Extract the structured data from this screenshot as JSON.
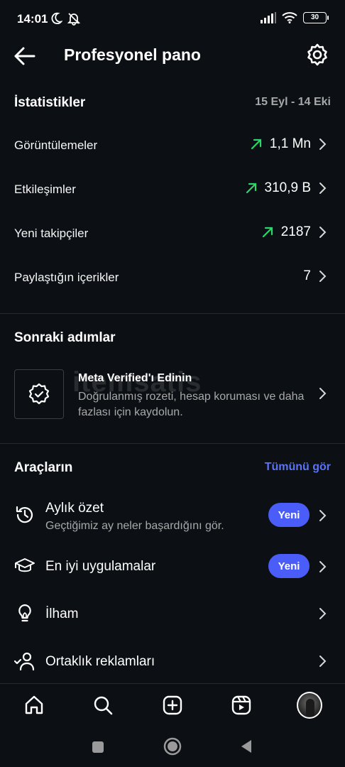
{
  "status_bar": {
    "time": "14:01",
    "battery": "30",
    "icons": [
      "moon-icon",
      "bell-off-icon",
      "signal-icon",
      "wifi-icon",
      "battery-icon"
    ]
  },
  "header": {
    "title": "Profesyonel pano",
    "back_icon": "arrow-left-icon",
    "settings_icon": "gear-icon"
  },
  "stats": {
    "title": "İstatistikler",
    "date_range": "15 Eyl - 14 Eki",
    "rows": [
      {
        "label": "Görüntülemeler",
        "value": "1,1 Mn",
        "trend": "up"
      },
      {
        "label": "Etkileşimler",
        "value": "310,9 B",
        "trend": "up"
      },
      {
        "label": "Yeni takipçiler",
        "value": "2187",
        "trend": "up"
      },
      {
        "label": "Paylaştığın içerikler",
        "value": "7",
        "trend": "none"
      }
    ]
  },
  "next_steps": {
    "title": "Sonraki adımlar",
    "card": {
      "title": "Meta Verified'ı Edinin",
      "description": "Doğrulanmış rozeti, hesap koruması ve daha fazlası için kaydolun.",
      "icon": "verified-badge-icon"
    }
  },
  "watermark": "itemsatis",
  "tools": {
    "title": "Araçların",
    "see_all": "Tümünü gör",
    "items": [
      {
        "title": "Aylık özet",
        "subtitle": "Geçtiğimiz ay neler başardığını gör.",
        "badge": "Yeni",
        "icon": "history-icon"
      },
      {
        "title": "En iyi uygulamalar",
        "subtitle": "",
        "badge": "Yeni",
        "icon": "graduation-cap-icon"
      },
      {
        "title": "İlham",
        "subtitle": "",
        "badge": "",
        "icon": "lightbulb-icon"
      },
      {
        "title": "Ortaklık reklamları",
        "subtitle": "",
        "badge": "",
        "icon": "partner-check-icon"
      }
    ]
  },
  "bottom_nav": {
    "items": [
      "home-icon",
      "search-icon",
      "create-icon",
      "reels-icon",
      "profile-avatar"
    ]
  },
  "colors": {
    "background": "#0c1014",
    "accent": "#4a5df9",
    "link": "#5b73f5",
    "trend_up": "#2dd66b",
    "muted_text": "#a8a8a8"
  }
}
